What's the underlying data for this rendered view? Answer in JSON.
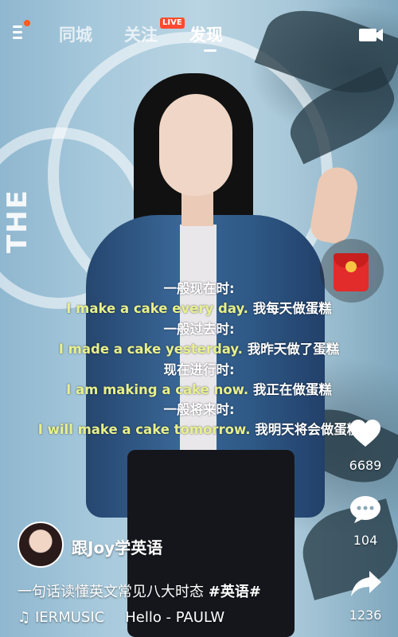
{
  "nav": {
    "tabs": [
      {
        "label": "同城"
      },
      {
        "label": "关注"
      },
      {
        "label": "发现"
      }
    ],
    "live_badge": "LIVE",
    "menu_icon": "menu-icon",
    "tv_icon": "tv-icon"
  },
  "background": {
    "wall_text": "THE"
  },
  "subtitles": {
    "lines": [
      {
        "head": "一般现在时:"
      },
      {
        "en": "I make a cake every day.",
        "zh": "我每天做蛋糕"
      },
      {
        "head": "一般过去时:"
      },
      {
        "en": "I made a cake yesterday.",
        "zh": "我昨天做了蛋糕"
      },
      {
        "head": "现在进行时:"
      },
      {
        "en": "I am making a cake now.",
        "zh": "我正在做蛋糕"
      },
      {
        "head": "一般将来时:"
      },
      {
        "en": "I will make a cake tomorrow.",
        "zh": "我明天将会做蛋糕"
      }
    ]
  },
  "actions": {
    "like_count": "6689",
    "comment_count": "104",
    "share_count": "1236",
    "icons": [
      "red-packet-icon",
      "heart-icon",
      "comment-icon",
      "share-icon"
    ]
  },
  "author": {
    "name": "跟Joy学英语"
  },
  "caption": {
    "text": "一句话读懂英文常见八大时态 ",
    "hashtag": "#英语#"
  },
  "music": {
    "part1": "IERMUSIC",
    "part2": "Hello - PAULW"
  },
  "colors": {
    "accent": "#ff4a2f",
    "subtitle_english": "#e8f08c"
  }
}
